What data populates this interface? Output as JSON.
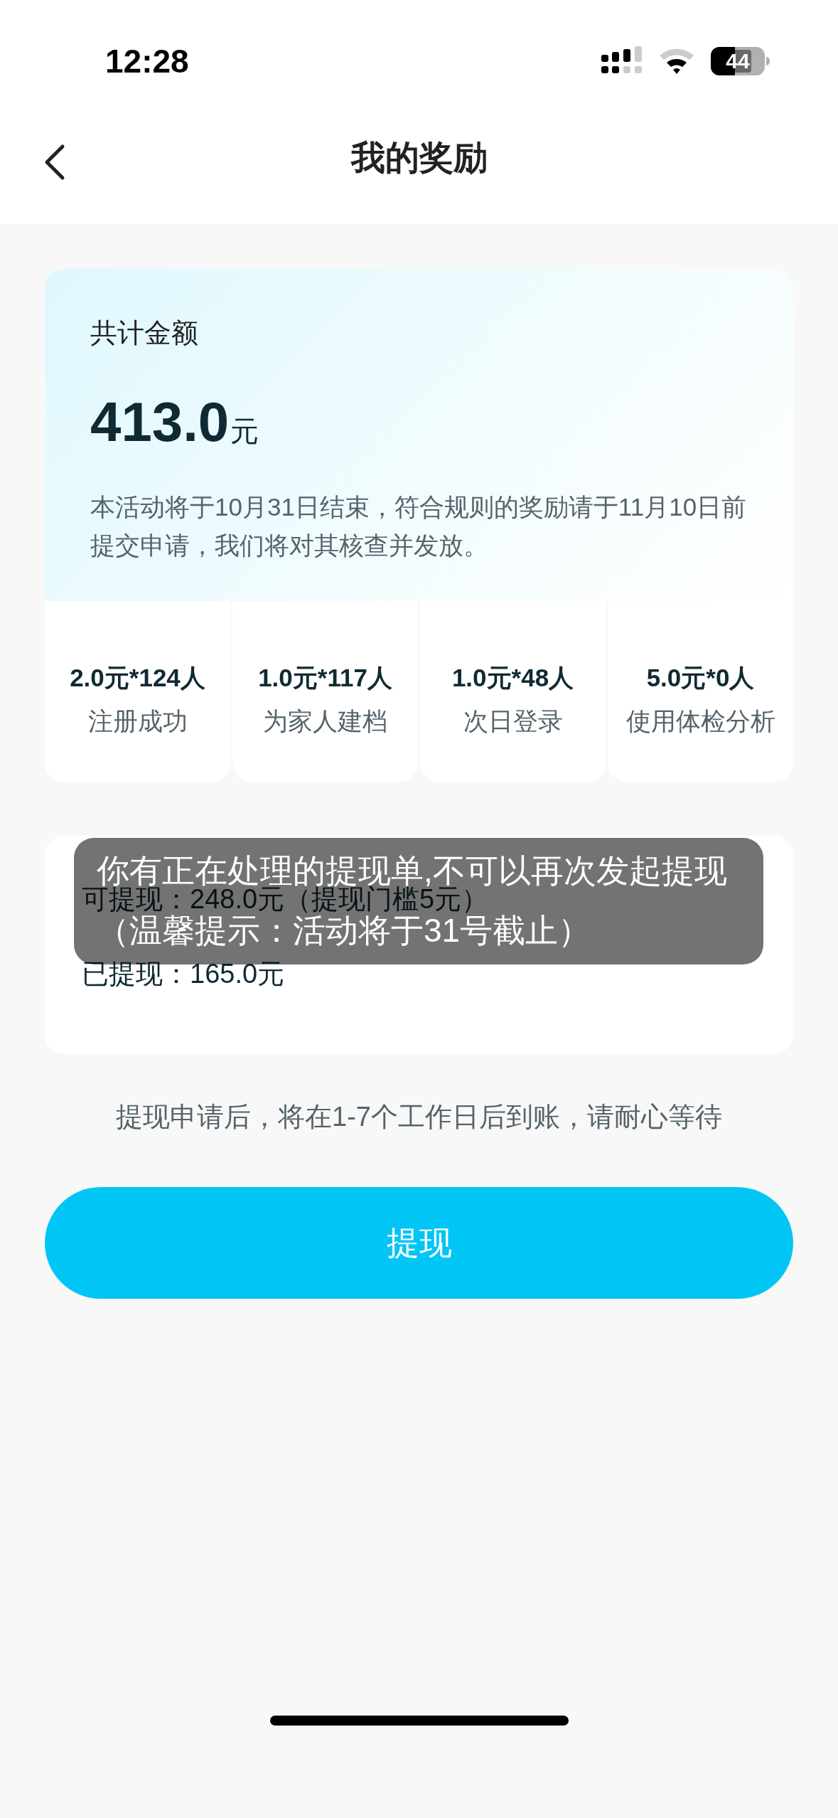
{
  "status_bar": {
    "time": "12:28",
    "battery": "44"
  },
  "nav": {
    "title": "我的奖励"
  },
  "summary": {
    "label": "共计金额",
    "amount": "413.0",
    "unit": "元",
    "note": "本活动将于10月31日结束，符合规则的奖励请于11月10日前提交申请，我们将对其核查并发放。"
  },
  "stats": [
    {
      "value": "2.0元*124人",
      "label": "注册成功"
    },
    {
      "value": "1.0元*117人",
      "label": "为家人建档"
    },
    {
      "value": "1.0元*48人",
      "label": "次日登录"
    },
    {
      "value": "5.0元*0人",
      "label": "使用体检分析"
    }
  ],
  "withdraw": {
    "available": "可提现：248.0元（提现门槛5元）",
    "withdrawn": "已提现：165.0元"
  },
  "toast": "你有正在处理的提现单,不可以再次发起提现（温馨提示：活动将于31号截止）",
  "hint": "提现申请后，将在1-7个工作日后到账，请耐心等待",
  "button": "提现"
}
